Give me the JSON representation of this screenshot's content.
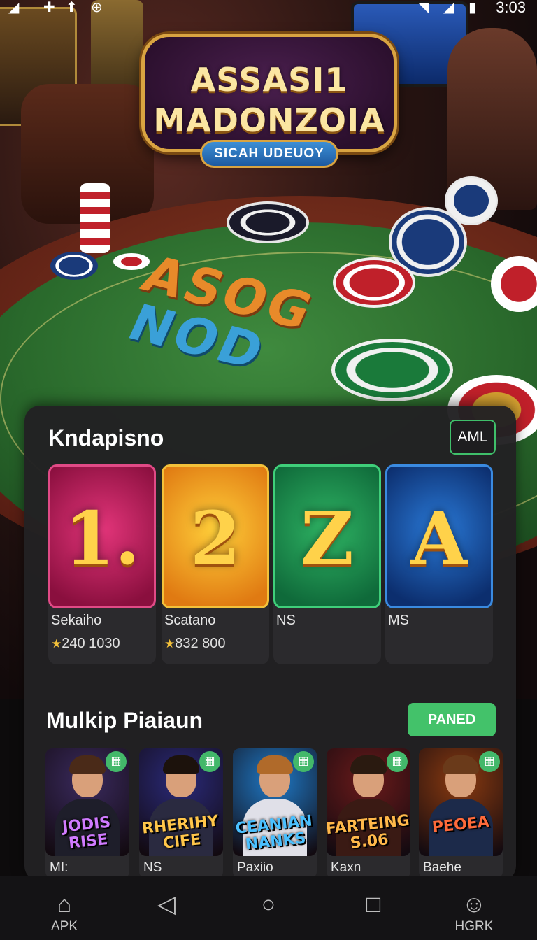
{
  "status_bar": {
    "time": "3:03",
    "icons": [
      "signal-icon",
      "plus-icon",
      "shield-icon",
      "globe-icon",
      "wifi-icon",
      "cell-signal-icon",
      "battery-icon"
    ]
  },
  "hero": {
    "logo_line1": "ASSASI1",
    "logo_line2": "MADONZOIA",
    "logo_subtitle": "SICAH UDEUOY",
    "felt_line1": "ASOG",
    "felt_line2": "NOD"
  },
  "section1": {
    "title": "Kndapisno",
    "action_label": "AML",
    "cards": [
      {
        "glyph": "1.",
        "name": "Sekaiho",
        "score": "240 1030",
        "color_from": "#e3357a",
        "color_to": "#8a0f3e",
        "border": "#e14a86"
      },
      {
        "glyph": "2",
        "name": "Scatano",
        "score": "832 800",
        "color_from": "#ffcf3a",
        "color_to": "#e07a12",
        "border": "#f3c13a"
      },
      {
        "glyph": "Z",
        "name": "NS",
        "score": "",
        "color_from": "#2fb464",
        "color_to": "#0f6a3a",
        "border": "#3fcf7a"
      },
      {
        "glyph": "A",
        "name": "MS",
        "score": "",
        "color_from": "#2a7ad8",
        "color_to": "#0c2e6e",
        "border": "#3a8ae0"
      }
    ]
  },
  "section2": {
    "title": "Mulkip Piaiaun",
    "action_label": "PANED",
    "tiles": [
      {
        "name": "MI:",
        "title_art": "JODIS RISE",
        "bg": "#3a2a5e",
        "hair": "#4a2a18",
        "body": "#1e1e2a",
        "title_color": "#d07aff"
      },
      {
        "name": "NS",
        "title_art": "RHERIHY CIFE",
        "bg": "#2a2a7a",
        "hair": "#1c120c",
        "body": "#2a2a40",
        "title_color": "#ffc64a"
      },
      {
        "name": "Paxiio",
        "title_art": "CEANIAN NANKS",
        "bg": "#1f7ac8",
        "hair": "#b06a2a",
        "body": "#e0e0e8",
        "title_color": "#4ac0ff"
      },
      {
        "name": "Kaxn",
        "title_art": "FARTEING S.06",
        "bg": "#6a1a1a",
        "hair": "#2a1a10",
        "body": "#3a1a14",
        "title_color": "#ffb84a"
      },
      {
        "name": "Baehe",
        "title_art": "PEOEA",
        "bg": "#8a3a10",
        "hair": "#6a3a1a",
        "body": "#1c2a4a",
        "title_color": "#ff6a3a"
      }
    ]
  },
  "navbar": {
    "items": [
      {
        "icon": "home-icon",
        "label": "APK"
      },
      {
        "icon": "back-icon",
        "label": ""
      },
      {
        "icon": "home-circle-icon",
        "label": ""
      },
      {
        "icon": "recents-icon",
        "label": ""
      },
      {
        "icon": "profile-icon",
        "label": "HGRK"
      }
    ]
  }
}
